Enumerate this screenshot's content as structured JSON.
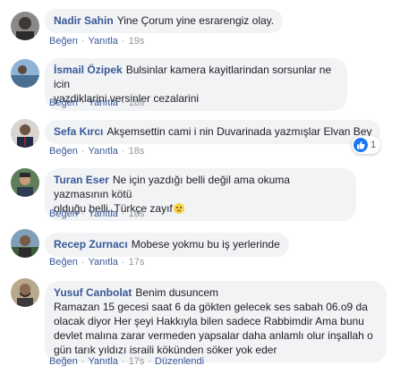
{
  "actions": {
    "like": "Beğen",
    "reply": "Yanıtla",
    "edited": "Düzenlendi"
  },
  "comments": [
    {
      "author": "Nadir Sahin",
      "text": "Yine Çorum yine esrarengiz olay.",
      "time": "19s"
    },
    {
      "author": "İsmail Özipek",
      "text_lines": [
        "Bulsinlar kamera kayitlarindan sorsunlar ne icin",
        "yazdiklarini versinler cezalarini"
      ],
      "time": "18s"
    },
    {
      "author": "Sefa Kırcı",
      "text": "Akşemsettin cami i nin Duvarinada yazmışlar Elvan Bey",
      "time": "18s",
      "reaction": {
        "icon": "like-icon",
        "count": "1"
      }
    },
    {
      "author": "Turan Eser",
      "text_lines": [
        "Ne için yazdığı belli değil ama okuma yazmasının kötü",
        "olduğu belli..Türkçe zayıf"
      ],
      "emoji": "confused-face",
      "time": "18s"
    },
    {
      "author": "Recep Zurnacı",
      "text": "Mobese yokmu bu iş yerlerinde",
      "time": "17s"
    },
    {
      "author": "Yusuf Canbolat",
      "text_lines": [
        "Benim dusuncem",
        "Ramazan 15 gecesi saat 6 da gökten gelecek ses sabah 06.o9 da",
        "olacak diyor Her şeyi Hakkıyla bilen sadece Rabbimdir Ama bunu",
        "devlet malına zarar vermeden yapsalar daha anlamlı olur inşallah o",
        "gün tarık yıldızı israili kökünden söker yok eder"
      ],
      "time": "17s",
      "edited": true
    }
  ],
  "colors": {
    "author": "#385898",
    "bubble": "#f2f3f5",
    "meta": "#90949c",
    "like_blue": "#1877f2"
  }
}
